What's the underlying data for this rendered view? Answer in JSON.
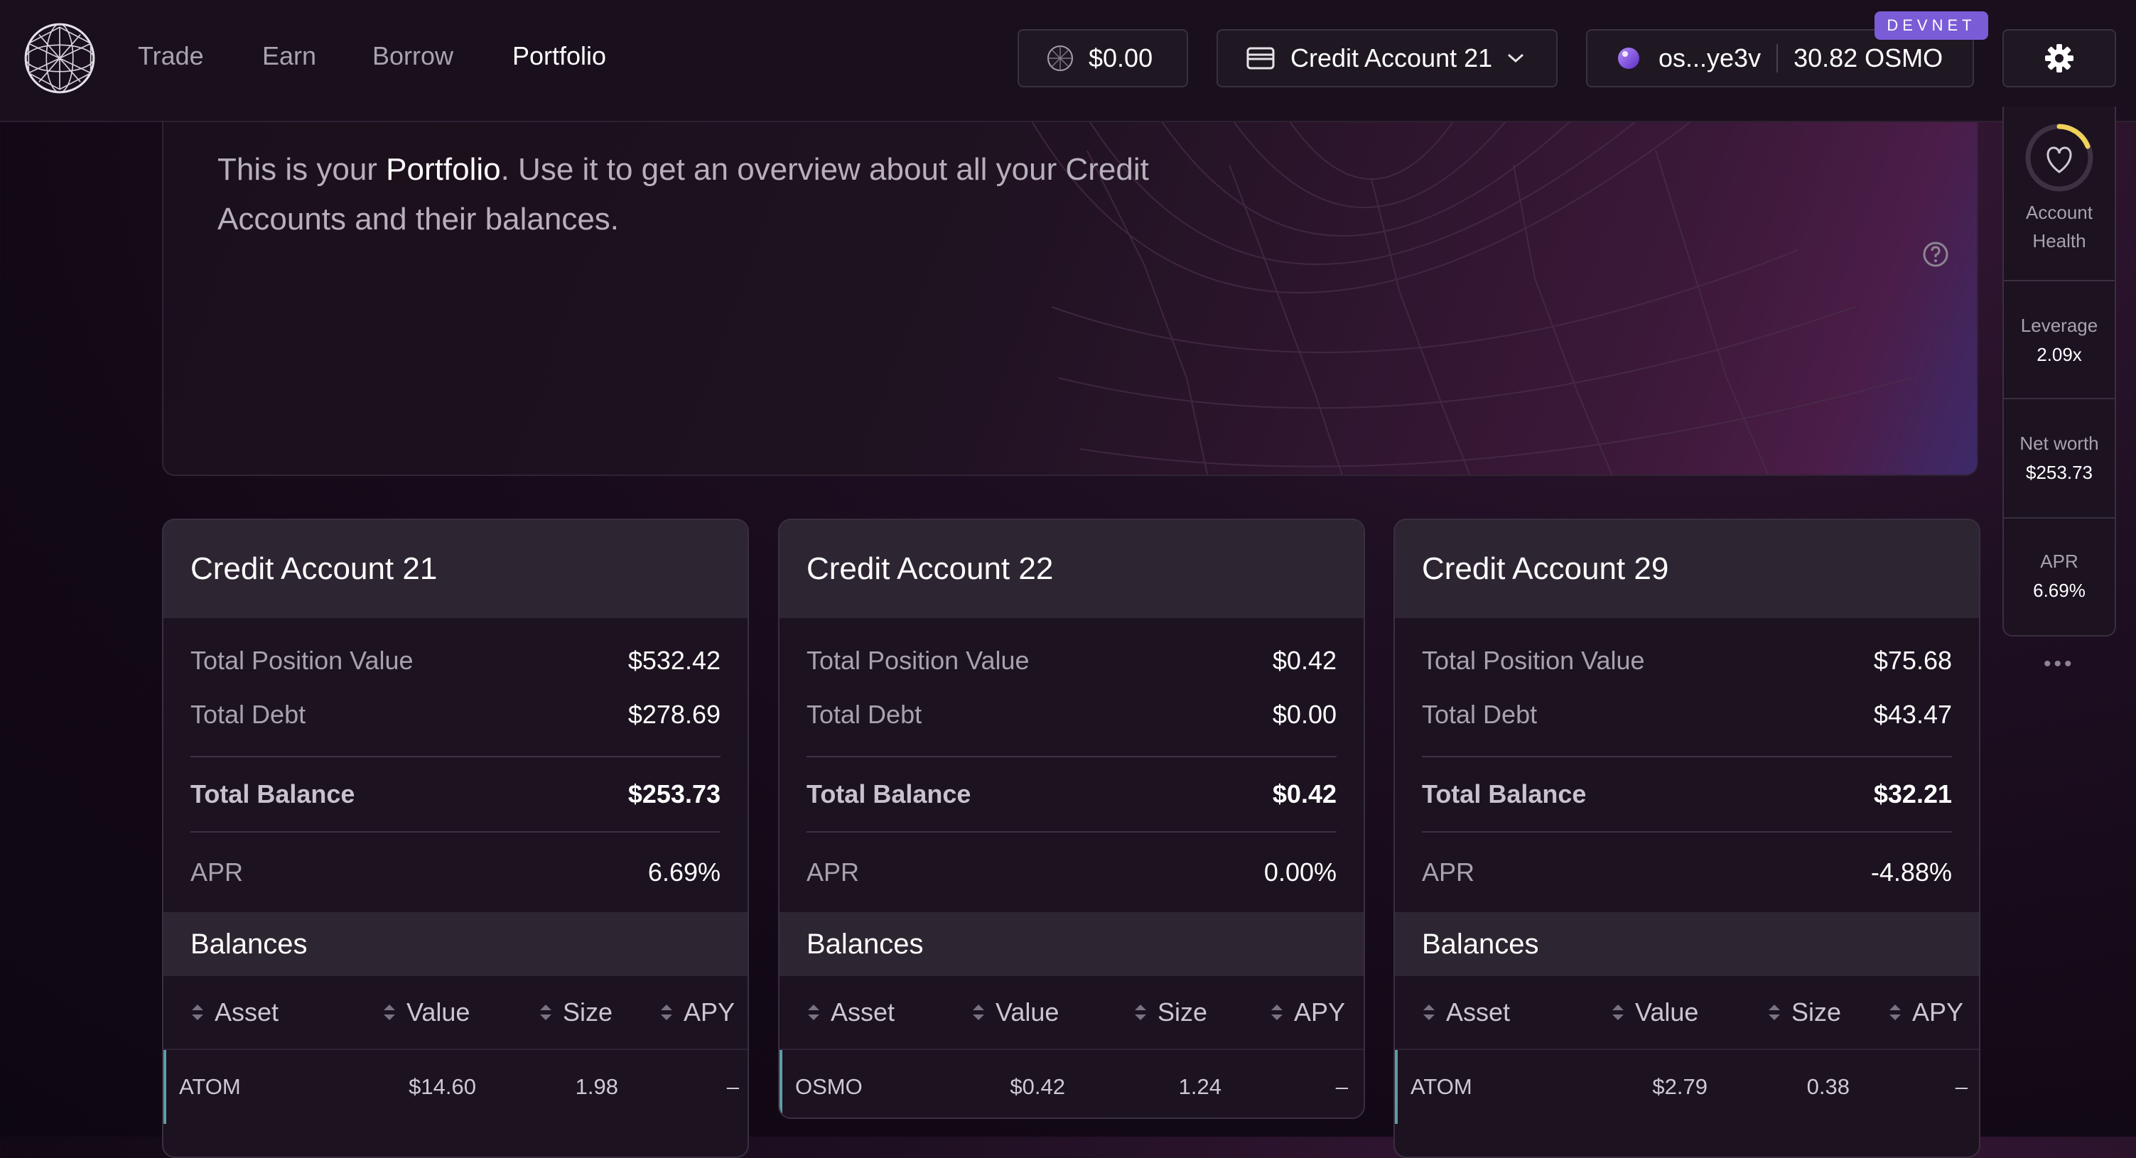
{
  "nav": {
    "links": [
      "Trade",
      "Earn",
      "Borrow",
      "Portfolio"
    ],
    "active": "Portfolio"
  },
  "header": {
    "rewards_value": "$0.00",
    "account_selector": "Credit Account 21",
    "wallet_address": "os...ye3v",
    "wallet_balance": "30.82 OSMO",
    "network_badge": "DEVNET"
  },
  "hero": {
    "text_prefix": "This is your ",
    "text_highlight": "Portfolio",
    "text_suffix": ". Use it to get an overview about all your Credit Accounts and their balances."
  },
  "summary": {
    "health_label": "Account Health",
    "leverage_label": "Leverage",
    "leverage_value": "2.09x",
    "networth_label": "Net worth",
    "networth_value": "$253.73",
    "apr_label": "APR",
    "apr_value": "6.69%"
  },
  "labels": {
    "total_position_value": "Total Position Value",
    "total_debt": "Total Debt",
    "total_balance": "Total Balance",
    "apr": "APR",
    "balances": "Balances",
    "col_asset": "Asset",
    "col_value": "Value",
    "col_size": "Size",
    "col_apy": "APY"
  },
  "accounts": [
    {
      "name": "Credit Account 21",
      "total_position_value": "$532.42",
      "total_debt": "$278.69",
      "total_balance": "$253.73",
      "apr": "6.69%",
      "balances": [
        {
          "asset": "ATOM",
          "value": "$14.60",
          "size": "1.98",
          "apy": "–"
        }
      ]
    },
    {
      "name": "Credit Account 22",
      "total_position_value": "$0.42",
      "total_debt": "$0.00",
      "total_balance": "$0.42",
      "apr": "0.00%",
      "balances": [
        {
          "asset": "OSMO",
          "value": "$0.42",
          "size": "1.24",
          "apy": "–"
        }
      ]
    },
    {
      "name": "Credit Account 29",
      "total_position_value": "$75.68",
      "total_debt": "$43.47",
      "total_balance": "$32.21",
      "apr": "-4.88%",
      "balances": [
        {
          "asset": "ATOM",
          "value": "$2.79",
          "size": "0.38",
          "apy": "–"
        }
      ]
    }
  ],
  "colors": {
    "accent": "#7a5cd6",
    "health_ring": "#f0d25a",
    "row_marker": "#5c9ea6"
  }
}
